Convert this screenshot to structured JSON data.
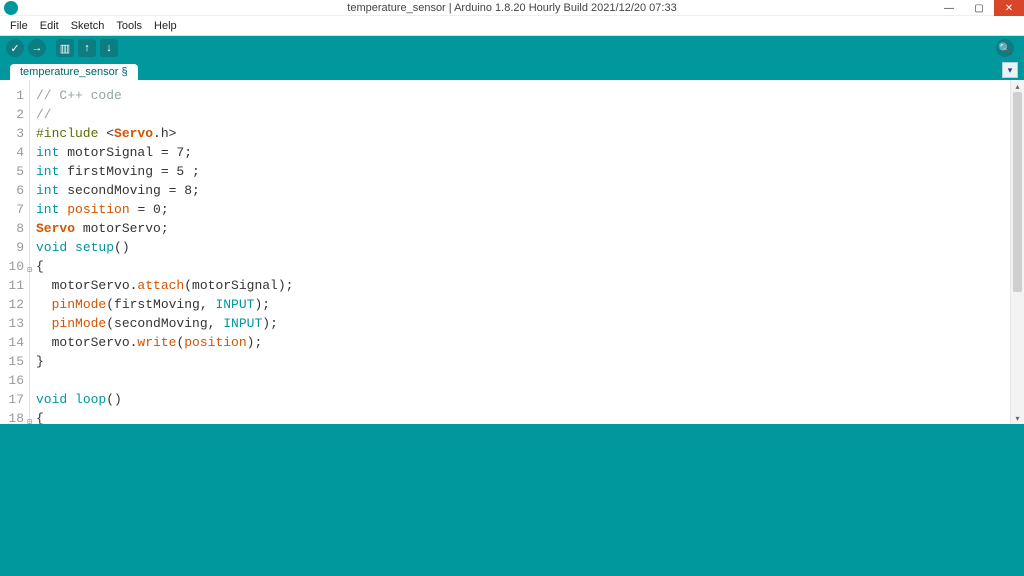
{
  "window": {
    "title": "temperature_sensor | Arduino 1.8.20 Hourly Build 2021/12/20 07:33",
    "minimize": "—",
    "maximize": "▢",
    "close": "✕"
  },
  "menu": {
    "file": "File",
    "edit": "Edit",
    "sketch": "Sketch",
    "tools": "Tools",
    "help": "Help"
  },
  "toolbar": {
    "verify": "✓",
    "upload": "→",
    "new": "▥",
    "open": "↑",
    "save": "↓",
    "serial": "🔍"
  },
  "tab": {
    "name": "temperature_sensor §",
    "menu": "▾"
  },
  "editor": {
    "lines": [
      {
        "n": "1",
        "tokens": [
          [
            "// C++ code",
            "comment"
          ]
        ]
      },
      {
        "n": "2",
        "tokens": [
          [
            "//",
            "comment"
          ]
        ]
      },
      {
        "n": "3",
        "tokens": [
          [
            "#include ",
            "pre"
          ],
          [
            "<",
            "sym"
          ],
          [
            "Servo",
            "classname"
          ],
          [
            ".h>",
            "sym"
          ]
        ]
      },
      {
        "n": "4",
        "tokens": [
          [
            "int ",
            "type"
          ],
          [
            "motorSignal = 7;",
            "sym"
          ]
        ]
      },
      {
        "n": "5",
        "tokens": [
          [
            "int ",
            "type"
          ],
          [
            "firstMoving = 5 ;",
            "sym"
          ]
        ]
      },
      {
        "n": "6",
        "tokens": [
          [
            "int ",
            "type"
          ],
          [
            "secondMoving = 8;",
            "sym"
          ]
        ]
      },
      {
        "n": "7",
        "tokens": [
          [
            "int ",
            "type"
          ],
          [
            "position",
            "func"
          ],
          [
            " = 0;",
            "sym"
          ]
        ]
      },
      {
        "n": "8",
        "tokens": [
          [
            "Servo",
            "classname"
          ],
          [
            " motorServo;",
            "sym"
          ]
        ]
      },
      {
        "n": "9",
        "tokens": [
          [
            "void ",
            "type"
          ],
          [
            "setup",
            "kw"
          ],
          [
            "()",
            "sym"
          ]
        ]
      },
      {
        "n": "10",
        "fold": "⊟",
        "tokens": [
          [
            "{",
            "sym"
          ]
        ]
      },
      {
        "n": "11",
        "tokens": [
          [
            "  motorServo.",
            "sym"
          ],
          [
            "attach",
            "func"
          ],
          [
            "(motorSignal);",
            "sym"
          ]
        ]
      },
      {
        "n": "12",
        "tokens": [
          [
            "  ",
            "sym"
          ],
          [
            "pinMode",
            "func"
          ],
          [
            "(firstMoving, ",
            "sym"
          ],
          [
            "INPUT",
            "const"
          ],
          [
            ");",
            "sym"
          ]
        ]
      },
      {
        "n": "13",
        "tokens": [
          [
            "  ",
            "sym"
          ],
          [
            "pinMode",
            "func"
          ],
          [
            "(secondMoving, ",
            "sym"
          ],
          [
            "INPUT",
            "const"
          ],
          [
            ");",
            "sym"
          ]
        ]
      },
      {
        "n": "14",
        "tokens": [
          [
            "  motorServo.",
            "sym"
          ],
          [
            "write",
            "func"
          ],
          [
            "(",
            "sym"
          ],
          [
            "position",
            "func"
          ],
          [
            ");",
            "sym"
          ]
        ]
      },
      {
        "n": "15",
        "tokens": [
          [
            "}",
            "sym"
          ]
        ]
      },
      {
        "n": "16",
        "tokens": [
          [
            " ",
            "sym"
          ]
        ]
      },
      {
        "n": "17",
        "tokens": [
          [
            "void ",
            "type"
          ],
          [
            "loop",
            "kw"
          ],
          [
            "()",
            "sym"
          ]
        ]
      },
      {
        "n": "18",
        "fold": "⊟",
        "tokens": [
          [
            "{",
            "sym"
          ]
        ]
      }
    ]
  },
  "scroll": {
    "up": "▴",
    "down": "▾"
  }
}
